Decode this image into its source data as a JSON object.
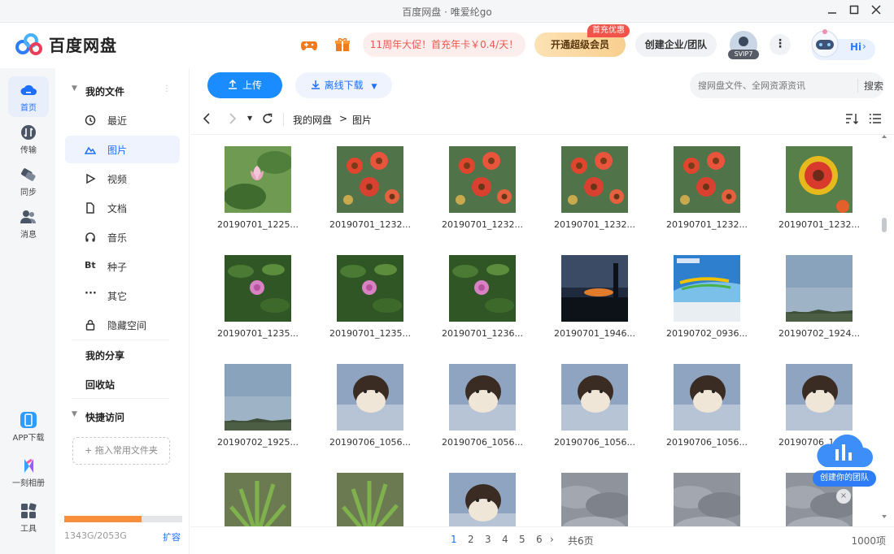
{
  "window": {
    "title": "百度网盘  ·  唯爱纶go"
  },
  "header": {
    "logo": "百度网盘",
    "promo": "11周年大促！首充年卡￥0.4/天！",
    "vip_label": "开通超级会员",
    "vip_badge": "首充优惠",
    "enterprise": "创建企业/团队",
    "svip": "SVIP7",
    "hi": "Hi"
  },
  "rail": [
    {
      "label": "首页",
      "icon": "cloud-home-icon"
    },
    {
      "label": "传输",
      "icon": "transfer-icon"
    },
    {
      "label": "同步",
      "icon": "sync-icon"
    },
    {
      "label": "消息",
      "icon": "message-icon"
    },
    {
      "label": "APP下载",
      "icon": "app-download-icon"
    },
    {
      "label": "一刻相册",
      "icon": "album-icon"
    },
    {
      "label": "工具",
      "icon": "tools-icon"
    }
  ],
  "nav": {
    "my_files": "我的文件",
    "items": [
      {
        "label": "最近",
        "icon": "clock-icon"
      },
      {
        "label": "图片",
        "icon": "image-icon"
      },
      {
        "label": "视频",
        "icon": "play-icon"
      },
      {
        "label": "文档",
        "icon": "document-icon"
      },
      {
        "label": "音乐",
        "icon": "headphones-icon"
      },
      {
        "label": "种子",
        "icon": "bt-icon"
      },
      {
        "label": "其它",
        "icon": "more-dots-icon"
      },
      {
        "label": "隐藏空间",
        "icon": "lock-icon"
      }
    ],
    "my_share": "我的分享",
    "recycle": "回收站",
    "quick_access": "快捷访问",
    "drop_hint": "+ 拖入常用文件夹",
    "storage_text": "1343G/2053G",
    "storage_fraction": 0.654,
    "expand": "扩容"
  },
  "toolbar": {
    "upload": "上传",
    "offline": "离线下载",
    "search_placeholder": "搜网盘文件、全网资源资讯",
    "search_btn": "搜索"
  },
  "breadcrumb": {
    "root": "我的网盘",
    "sep": ">",
    "current": "图片"
  },
  "files": [
    {
      "name": "20190701_1225...",
      "kind": "lotus"
    },
    {
      "name": "20190701_1232...",
      "kind": "flowers"
    },
    {
      "name": "20190701_1232...",
      "kind": "flowers"
    },
    {
      "name": "20190701_1232...",
      "kind": "flowers"
    },
    {
      "name": "20190701_1232...",
      "kind": "flowers"
    },
    {
      "name": "20190701_1232...",
      "kind": "flower"
    },
    {
      "name": "20190701_1235...",
      "kind": "pinkflower"
    },
    {
      "name": "20190701_1235...",
      "kind": "pinkflower"
    },
    {
      "name": "20190701_1236...",
      "kind": "pinkflower"
    },
    {
      "name": "20190701_1946...",
      "kind": "sunset"
    },
    {
      "name": "20190702_0936...",
      "kind": "card"
    },
    {
      "name": "20190702_1924...",
      "kind": "sky"
    },
    {
      "name": "20190702_1925...",
      "kind": "sky"
    },
    {
      "name": "20190706_1056...",
      "kind": "cat"
    },
    {
      "name": "20190706_1056...",
      "kind": "cat"
    },
    {
      "name": "20190706_1056...",
      "kind": "cat"
    },
    {
      "name": "20190706_1056...",
      "kind": "cat"
    },
    {
      "name": "20190706_1056...",
      "kind": "cat"
    },
    {
      "name": "",
      "kind": "plant"
    },
    {
      "name": "",
      "kind": "plant"
    },
    {
      "name": "",
      "kind": "cat"
    },
    {
      "name": "",
      "kind": "clouds"
    },
    {
      "name": "",
      "kind": "clouds"
    },
    {
      "name": "",
      "kind": "clouds"
    }
  ],
  "pagination": {
    "pages": [
      "1",
      "2",
      "3",
      "4",
      "5",
      "6"
    ],
    "current": "1",
    "total": "共6页",
    "count": "1000项"
  },
  "team": {
    "label": "创建你的团队",
    "close": "×"
  },
  "colors": {
    "accent": "#1a8cff",
    "storage": "#f78f3c",
    "promo": "#e85a4f"
  }
}
